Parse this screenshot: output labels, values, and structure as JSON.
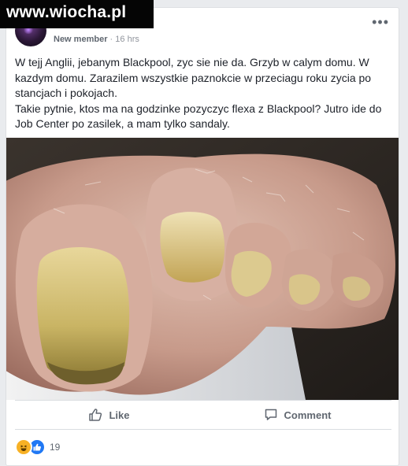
{
  "watermark": {
    "text": "www.wiocha.pl"
  },
  "post": {
    "author_role": "New member",
    "separator": "·",
    "timestamp": "16 hrs",
    "paragraphs": [
      "W tejj Anglii, jebanym Blackpool, zyc sie nie da. Grzyb w calym domu. W kazdym domu. Zarazilem wszystkie paznokcie w przeciagu roku zycia po stancjach i pokojach.",
      "Takie pytnie, ktos ma na godzinke pozyczyc flexa z Blackpool? Jutro ide do Job Center po zasilek, a mam tylko sandaly."
    ],
    "photo_subject": "close-up photo of fungus-infected toenails",
    "menu_icon": "more-options-icon"
  },
  "actions": {
    "like_label": "Like",
    "comment_label": "Comment",
    "like_icon": "thumbs-up-icon",
    "comment_icon": "comment-bubble-icon"
  },
  "reactions": {
    "types": [
      "haha",
      "like"
    ],
    "count": "19"
  },
  "colors": {
    "page_background": "#e9ebee",
    "card_background": "#ffffff",
    "text_primary": "#1d2129",
    "text_secondary": "#606770",
    "like_blue": "#2078f4",
    "haha_yellow": "#f7b125"
  }
}
